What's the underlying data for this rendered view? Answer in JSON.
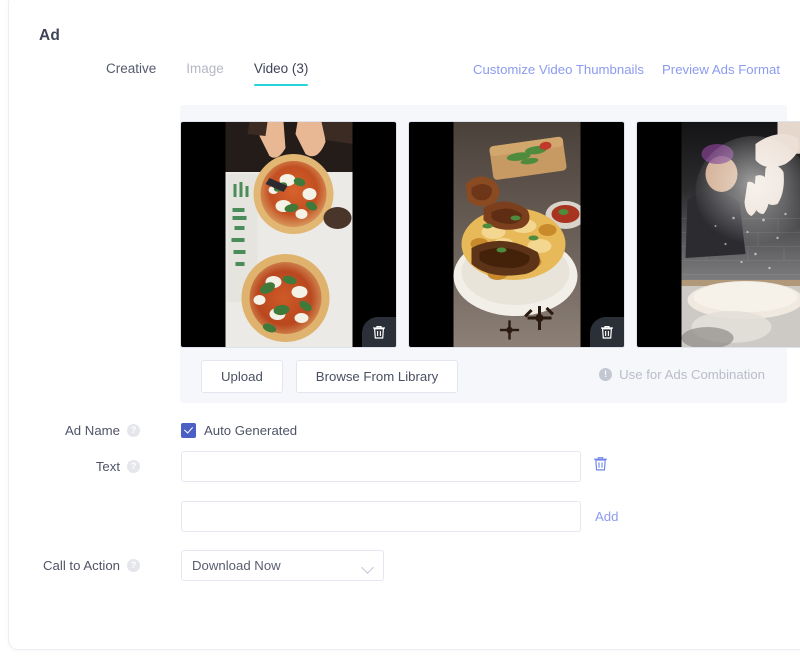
{
  "card": {
    "title": "Ad"
  },
  "tabs": [
    {
      "label": "Creative",
      "state": "normal"
    },
    {
      "label": "Image",
      "state": "muted"
    },
    {
      "label": "Video (3)",
      "state": "active"
    }
  ],
  "header_links": [
    {
      "label": "Customize Video Thumbnails"
    },
    {
      "label": "Preview Ads Format"
    }
  ],
  "media": {
    "thumbnails": [
      {
        "alt": "two margherita pizzas with hands cutting",
        "delete_icon": "trash-icon"
      },
      {
        "alt": "biryani rice plate with roasted meat",
        "delete_icon": "trash-icon"
      },
      {
        "alt": "hands dusting flour over pizza dough",
        "delete_icon": "trash-icon"
      }
    ],
    "upload_label": "Upload",
    "browse_label": "Browse From Library",
    "combination_note": "Use for Ads Combination",
    "combination_icon": "exclamation-circle-icon"
  },
  "form": {
    "ad_name": {
      "label": "Ad Name",
      "help_icon": "help-circle-icon",
      "checkbox_label": "Auto Generated",
      "checked": true
    },
    "text": {
      "label": "Text",
      "help_icon": "help-circle-icon",
      "value": "",
      "placeholder": "",
      "delete_icon": "trash-icon",
      "second_value": "",
      "second_placeholder": "",
      "add_label": "Add"
    },
    "call_to_action": {
      "label": "Call to Action",
      "help_icon": "help-circle-icon",
      "value": "Download Now",
      "chevron_icon": "chevron-down-icon"
    }
  },
  "colors": {
    "accent_tab": "#25d5d8",
    "link": "#8c9bf0",
    "checkbox": "#4b5fc4",
    "panel_bg": "#f6f7fa"
  }
}
